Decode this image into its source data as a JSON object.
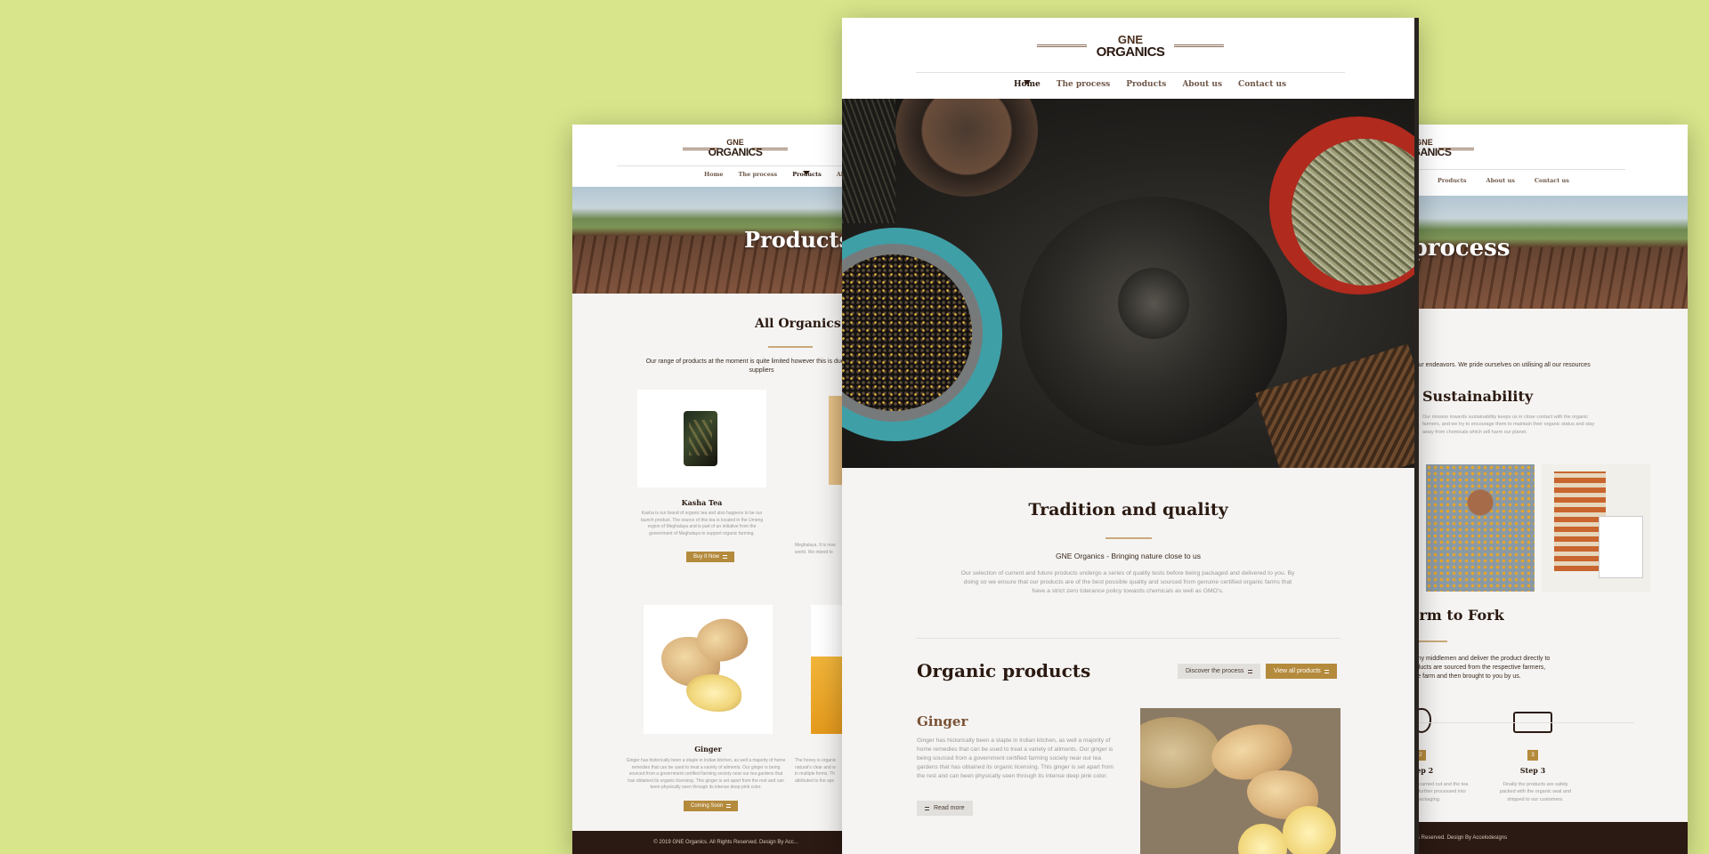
{
  "brand": {
    "top": "GNE",
    "bottom": "ORGANICS"
  },
  "left": {
    "nav": [
      "Home",
      "The process",
      "Products",
      "About us"
    ],
    "banner": "Products",
    "section_title": "All Organics",
    "intro": "Our range of products at the moment is quite limited however this is due to the stri... suppliers",
    "product1": {
      "name": "Kasha Tea",
      "desc": "Kasha is our brand of organic tea and also happens to be our launch product. The source of this tea is located in the Umeng region of Meghalaya and is part of an initiative from the government of Meghalaya to support organic farming.",
      "button": "Buy It Now"
    },
    "product2": {
      "name": "Ginger",
      "desc": "Ginger has historically been a staple in Indian kitchen, as well a majority of home remedies that can be used to treat a variety of ailments. Our ginger is being sourced from a government certified farming society near our tea gardens that has obtained its organic licensing. This ginger is set apart from the rest and can been physically seen through its intense deep pink color.",
      "button": "Coming Soon"
    },
    "footer": "© 2019 GNE Organics. All Rights Reserved. Design By Acc..."
  },
  "center": {
    "nav": [
      "Home",
      "The process",
      "Products",
      "About us",
      "Contact us"
    ],
    "headline": "Tradition and quality",
    "subhead": "GNE Organics - Bringing nature close to us",
    "paragraph": "Our selection of current and future products undergo a series of quality tests before being packaged and delivered to you. By doing so we ensure that our products are of the best possible quality and sourced from genuine certified organic farms that have a strict zero tolerance policy towards chemicals as well as GMO's.",
    "section2": "Organic products",
    "btn_process": "Discover the process",
    "btn_products": "View all products",
    "product_title": "Ginger",
    "product_desc": "Ginger has historically been a staple in Indian kitchen, as well a majority of home remedies that can be used to treat a variety of ailments. Our ginger is being sourced from a government certified farming society near our tea gardens that has obtained its organic licensing. This ginger is set apart from the rest and can been physically seen through its intense deep pink color.",
    "read_more": "Read more"
  },
  "right": {
    "nav": [
      "Products",
      "About us",
      "Contact us"
    ],
    "banner": "e process",
    "intro": "wards all our endeavors. We pride ourselves on utilising all our resources",
    "section1": "Sustainability",
    "section1_text": "Our mission towards sustainability keeps us in close contact with the organic farmers, and we try to encourage them to maintain their organic status and stay away from chemicals which will harm our planet.",
    "section2": "n farm to Fork",
    "section2_text": "o cut out any middlemen and deliver the product directly to you ur products are sourced from the respective farmers, packaged e farm and then brought to you by us.",
    "step2": "Step 2",
    "step3": "Step 3",
    "step2_text": "check is then carried out and the tea ds and then further processed into packaging.",
    "step3_text": "Finally the products are safely packed with the organic seal and shipped to our customers.",
    "step2_num": "2",
    "step3_num": "3",
    "footer": "ts. All Rights Reserved. Design By Accelodesigns"
  },
  "colors": {
    "background": "#d8e58a",
    "accent": "#b48a3c",
    "dark_brown": "#2b1a12"
  }
}
